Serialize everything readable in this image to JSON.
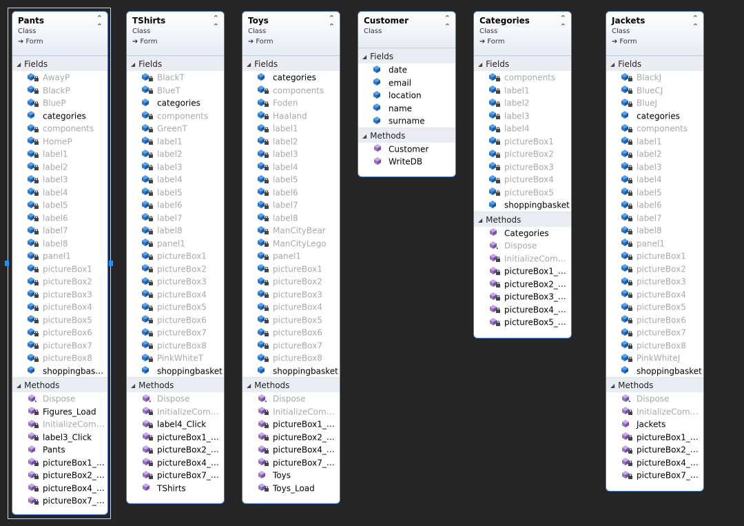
{
  "icons": {
    "field": "field-icon",
    "method": "method-icon",
    "section_toggle": "triangle-down-icon",
    "collapse": "double-chevron-up-icon",
    "inherit": "arrow-right-icon"
  },
  "colors": {
    "canvas": "#252526",
    "border": "#4a7cc7",
    "field_icon": "#2e77d0",
    "method_icon": "#9a6fc6",
    "private_text": "#a9a9a9",
    "selection_handle": "#1e90ff"
  },
  "classes": [
    {
      "name": "Pants",
      "stereotype": "Class",
      "base": "Form",
      "fields_label": "Fields",
      "fields": [
        {
          "name": "AwayP",
          "private": true
        },
        {
          "name": "BlackP",
          "private": true
        },
        {
          "name": "BlueP",
          "private": true
        },
        {
          "name": "categories",
          "private": false
        },
        {
          "name": "components",
          "private": true
        },
        {
          "name": "HomeP",
          "private": true
        },
        {
          "name": "label1",
          "private": true
        },
        {
          "name": "label2",
          "private": true
        },
        {
          "name": "label3",
          "private": true
        },
        {
          "name": "label4",
          "private": true
        },
        {
          "name": "label5",
          "private": true
        },
        {
          "name": "label6",
          "private": true
        },
        {
          "name": "label7",
          "private": true
        },
        {
          "name": "label8",
          "private": true
        },
        {
          "name": "panel1",
          "private": true
        },
        {
          "name": "pictureBox1",
          "private": true
        },
        {
          "name": "pictureBox2",
          "private": true
        },
        {
          "name": "pictureBox3",
          "private": true
        },
        {
          "name": "pictureBox4",
          "private": true
        },
        {
          "name": "pictureBox5",
          "private": true
        },
        {
          "name": "pictureBox6",
          "private": true
        },
        {
          "name": "pictureBox7",
          "private": true
        },
        {
          "name": "pictureBox8",
          "private": true
        },
        {
          "name": "shoppingbasket",
          "private": false
        }
      ],
      "methods_label": "Methods",
      "methods": [
        {
          "name": "Dispose",
          "private": true,
          "kind": "override"
        },
        {
          "name": "Figures_Load",
          "private": false,
          "kind": "private"
        },
        {
          "name": "InitializeCompo...",
          "private": true,
          "kind": "private"
        },
        {
          "name": "label3_Click",
          "private": false,
          "kind": "private"
        },
        {
          "name": "Pants",
          "private": false,
          "kind": "public"
        },
        {
          "name": "pictureBox1_Cli...",
          "private": false,
          "kind": "private"
        },
        {
          "name": "pictureBox2_Cli...",
          "private": false,
          "kind": "private"
        },
        {
          "name": "pictureBox4_Cli...",
          "private": false,
          "kind": "private"
        },
        {
          "name": "pictureBox7_Cli...",
          "private": false,
          "kind": "private"
        }
      ]
    },
    {
      "name": "TShirts",
      "stereotype": "Class",
      "base": "Form",
      "fields_label": "Fields",
      "fields": [
        {
          "name": "BlackT",
          "private": true
        },
        {
          "name": "BlueT",
          "private": true
        },
        {
          "name": "categories",
          "private": false
        },
        {
          "name": "components",
          "private": true
        },
        {
          "name": "GreenT",
          "private": true
        },
        {
          "name": "label1",
          "private": true
        },
        {
          "name": "label2",
          "private": true
        },
        {
          "name": "label3",
          "private": true
        },
        {
          "name": "label4",
          "private": true
        },
        {
          "name": "label5",
          "private": true
        },
        {
          "name": "label6",
          "private": true
        },
        {
          "name": "label7",
          "private": true
        },
        {
          "name": "label8",
          "private": true
        },
        {
          "name": "panel1",
          "private": true
        },
        {
          "name": "pictureBox1",
          "private": true
        },
        {
          "name": "pictureBox2",
          "private": true
        },
        {
          "name": "pictureBox3",
          "private": true
        },
        {
          "name": "pictureBox4",
          "private": true
        },
        {
          "name": "pictureBox5",
          "private": true
        },
        {
          "name": "pictureBox6",
          "private": true
        },
        {
          "name": "pictureBox7",
          "private": true
        },
        {
          "name": "pictureBox8",
          "private": true
        },
        {
          "name": "PinkWhiteT",
          "private": true
        },
        {
          "name": "shoppingbasket",
          "private": false
        }
      ],
      "methods_label": "Methods",
      "methods": [
        {
          "name": "Dispose",
          "private": true,
          "kind": "override"
        },
        {
          "name": "InitializeCompo...",
          "private": true,
          "kind": "private"
        },
        {
          "name": "label4_Click",
          "private": false,
          "kind": "private"
        },
        {
          "name": "pictureBox1_Cli...",
          "private": false,
          "kind": "private"
        },
        {
          "name": "pictureBox2_Cli...",
          "private": false,
          "kind": "private"
        },
        {
          "name": "pictureBox4_Cli...",
          "private": false,
          "kind": "private"
        },
        {
          "name": "pictureBox7_Cli...",
          "private": false,
          "kind": "private"
        },
        {
          "name": "TShirts",
          "private": false,
          "kind": "public"
        }
      ]
    },
    {
      "name": "Toys",
      "stereotype": "Class",
      "base": "Form",
      "fields_label": "Fields",
      "fields": [
        {
          "name": "categories",
          "private": false
        },
        {
          "name": "components",
          "private": true
        },
        {
          "name": "Foden",
          "private": true
        },
        {
          "name": "Haaland",
          "private": true
        },
        {
          "name": "label1",
          "private": true
        },
        {
          "name": "label2",
          "private": true
        },
        {
          "name": "label3",
          "private": true
        },
        {
          "name": "label4",
          "private": true
        },
        {
          "name": "label5",
          "private": true
        },
        {
          "name": "label6",
          "private": true
        },
        {
          "name": "label7",
          "private": true
        },
        {
          "name": "label8",
          "private": true
        },
        {
          "name": "ManCityBear",
          "private": true
        },
        {
          "name": "ManCityLego",
          "private": true
        },
        {
          "name": "panel1",
          "private": true
        },
        {
          "name": "pictureBox1",
          "private": true
        },
        {
          "name": "pictureBox2",
          "private": true
        },
        {
          "name": "pictureBox3",
          "private": true
        },
        {
          "name": "pictureBox4",
          "private": true
        },
        {
          "name": "pictureBox5",
          "private": true
        },
        {
          "name": "pictureBox6",
          "private": true
        },
        {
          "name": "pictureBox7",
          "private": true
        },
        {
          "name": "pictureBox8",
          "private": true
        },
        {
          "name": "shoppingbasket",
          "private": false
        }
      ],
      "methods_label": "Methods",
      "methods": [
        {
          "name": "Dispose",
          "private": true,
          "kind": "override"
        },
        {
          "name": "InitializeCompo...",
          "private": true,
          "kind": "private"
        },
        {
          "name": "pictureBox1_Cli...",
          "private": false,
          "kind": "private"
        },
        {
          "name": "pictureBox2_Cli...",
          "private": false,
          "kind": "private"
        },
        {
          "name": "pictureBox4_Cli...",
          "private": false,
          "kind": "private"
        },
        {
          "name": "pictureBox7_Cli...",
          "private": false,
          "kind": "private"
        },
        {
          "name": "Toys",
          "private": false,
          "kind": "public"
        },
        {
          "name": "Toys_Load",
          "private": false,
          "kind": "private"
        }
      ]
    },
    {
      "name": "Customer",
      "stereotype": "Class",
      "base": "",
      "fields_label": "Fields",
      "fields": [
        {
          "name": "date",
          "private": false
        },
        {
          "name": "email",
          "private": false
        },
        {
          "name": "location",
          "private": false
        },
        {
          "name": "name",
          "private": false
        },
        {
          "name": "surname",
          "private": false
        }
      ],
      "methods_label": "Methods",
      "methods": [
        {
          "name": "Customer",
          "private": false,
          "kind": "public"
        },
        {
          "name": "WriteDB",
          "private": false,
          "kind": "public"
        }
      ]
    },
    {
      "name": "Categories",
      "stereotype": "Class",
      "base": "Form",
      "fields_label": "Fields",
      "fields": [
        {
          "name": "components",
          "private": true
        },
        {
          "name": "label1",
          "private": true
        },
        {
          "name": "label2",
          "private": true
        },
        {
          "name": "label3",
          "private": true
        },
        {
          "name": "label4",
          "private": true
        },
        {
          "name": "pictureBox1",
          "private": true
        },
        {
          "name": "pictureBox2",
          "private": true
        },
        {
          "name": "pictureBox3",
          "private": true
        },
        {
          "name": "pictureBox4",
          "private": true
        },
        {
          "name": "pictureBox5",
          "private": true
        },
        {
          "name": "shoppingbasket",
          "private": false
        }
      ],
      "methods_label": "Methods",
      "methods": [
        {
          "name": "Categories",
          "private": false,
          "kind": "public"
        },
        {
          "name": "Dispose",
          "private": true,
          "kind": "override"
        },
        {
          "name": "InitializeCompo...",
          "private": true,
          "kind": "private"
        },
        {
          "name": "pictureBox1_Cli...",
          "private": false,
          "kind": "private"
        },
        {
          "name": "pictureBox2_Cli...",
          "private": false,
          "kind": "private"
        },
        {
          "name": "pictureBox3_Cli...",
          "private": false,
          "kind": "private"
        },
        {
          "name": "pictureBox4_Cli...",
          "private": false,
          "kind": "private"
        },
        {
          "name": "pictureBox5_Cli...",
          "private": false,
          "kind": "private"
        }
      ]
    },
    {
      "name": "Jackets",
      "stereotype": "Class",
      "base": "Form",
      "fields_label": "Fields",
      "fields": [
        {
          "name": "BlackJ",
          "private": true
        },
        {
          "name": "BlueCJ",
          "private": true
        },
        {
          "name": "BlueJ",
          "private": true
        },
        {
          "name": "categories",
          "private": false
        },
        {
          "name": "components",
          "private": true
        },
        {
          "name": "label1",
          "private": true
        },
        {
          "name": "label2",
          "private": true
        },
        {
          "name": "label3",
          "private": true
        },
        {
          "name": "label4",
          "private": true
        },
        {
          "name": "label5",
          "private": true
        },
        {
          "name": "label6",
          "private": true
        },
        {
          "name": "label7",
          "private": true
        },
        {
          "name": "label8",
          "private": true
        },
        {
          "name": "panel1",
          "private": true
        },
        {
          "name": "pictureBox1",
          "private": true
        },
        {
          "name": "pictureBox2",
          "private": true
        },
        {
          "name": "pictureBox3",
          "private": true
        },
        {
          "name": "pictureBox4",
          "private": true
        },
        {
          "name": "pictureBox5",
          "private": true
        },
        {
          "name": "pictureBox6",
          "private": true
        },
        {
          "name": "pictureBox7",
          "private": true
        },
        {
          "name": "pictureBox8",
          "private": true
        },
        {
          "name": "PinkWhiteJ",
          "private": true
        },
        {
          "name": "shoppingbasket",
          "private": false
        }
      ],
      "methods_label": "Methods",
      "methods": [
        {
          "name": "Dispose",
          "private": true,
          "kind": "override"
        },
        {
          "name": "InitializeCompo...",
          "private": true,
          "kind": "private"
        },
        {
          "name": "Jackets",
          "private": false,
          "kind": "public"
        },
        {
          "name": "pictureBox1_Cli...",
          "private": false,
          "kind": "private"
        },
        {
          "name": "pictureBox2_Cli...",
          "private": false,
          "kind": "private"
        },
        {
          "name": "pictureBox4_Cli...",
          "private": false,
          "kind": "private"
        },
        {
          "name": "pictureBox7_Cli...",
          "private": false,
          "kind": "private"
        }
      ]
    }
  ]
}
